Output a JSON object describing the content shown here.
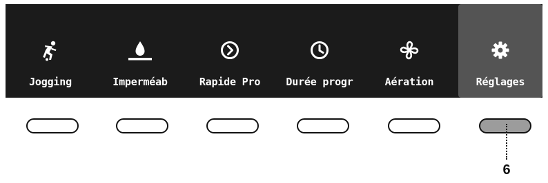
{
  "colors": {
    "panel_background": "#1b1b1b",
    "selected_tab_background": "#545454",
    "selected_button_fill": "#9c9c9c"
  },
  "tabs": [
    {
      "label": "Jogging",
      "icon": "jogging-icon",
      "selected": false
    },
    {
      "label": "Imperméab",
      "icon": "water-drop-icon",
      "selected": false
    },
    {
      "label": "Rapide Pro",
      "icon": "quick-arrow-icon",
      "selected": false
    },
    {
      "label": "Durée progr",
      "icon": "clock-icon",
      "selected": false
    },
    {
      "label": "Aération",
      "icon": "fan-icon",
      "selected": false
    },
    {
      "label": "Réglages",
      "icon": "gear-icon",
      "selected": true
    }
  ],
  "callout": {
    "number": "6"
  }
}
